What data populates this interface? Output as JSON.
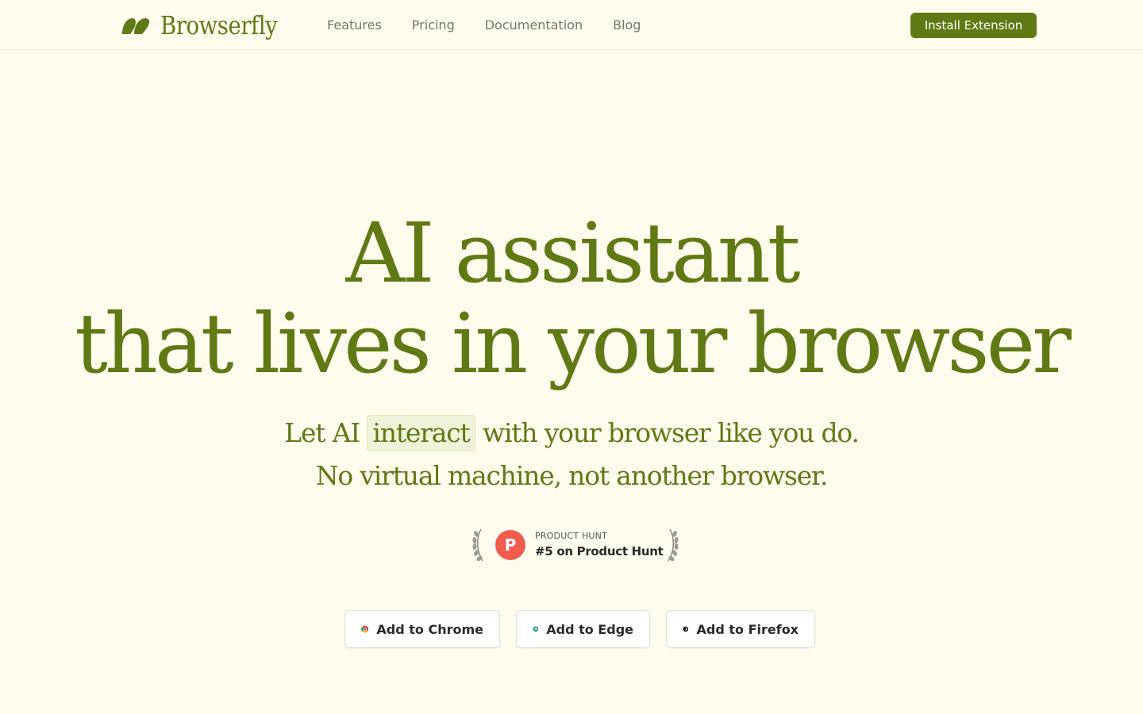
{
  "brand": {
    "name": "Browserfly",
    "logo_icon": "browserfly-wings-logo",
    "accent_color": "#5f7a14",
    "background_color": "#fffcee"
  },
  "nav": {
    "links": [
      {
        "label": "Features"
      },
      {
        "label": "Pricing"
      },
      {
        "label": "Documentation"
      },
      {
        "label": "Blog"
      }
    ],
    "install_label": "Install Extension"
  },
  "hero": {
    "title_line1": "AI assistant",
    "title_line2": "that lives in your browser",
    "sub1_before": "Let AI",
    "sub1_highlight": "interact",
    "sub1_after": "with your browser like you do.",
    "sub2": "No virtual machine, not another browser."
  },
  "product_hunt": {
    "small_label": "PRODUCT HUNT",
    "rank_label": "#5 on Product Hunt",
    "logo_letter": "P",
    "logo_color": "#f25c4c"
  },
  "cta": {
    "chrome_label": "Add to Chrome",
    "edge_label": "Add to Edge",
    "firefox_label": "Add to Firefox"
  }
}
